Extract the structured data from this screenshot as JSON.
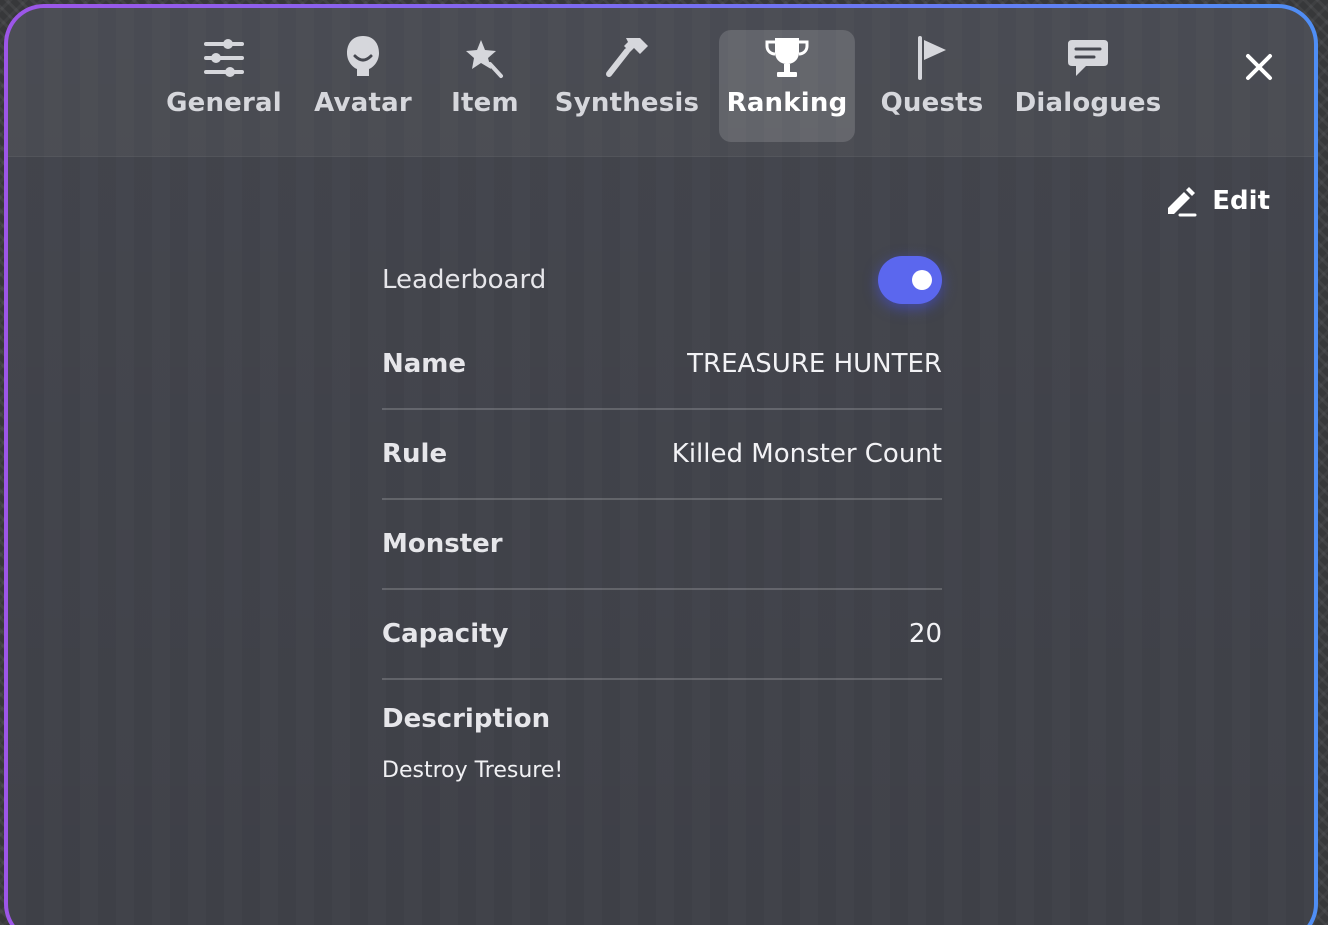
{
  "tabs": [
    {
      "label": "General",
      "icon": "sliders-icon"
    },
    {
      "label": "Avatar",
      "icon": "avatar-icon"
    },
    {
      "label": "Item",
      "icon": "star-wand-icon"
    },
    {
      "label": "Synthesis",
      "icon": "hammer-icon"
    },
    {
      "label": "Ranking",
      "icon": "trophy-icon",
      "active": true
    },
    {
      "label": "Quests",
      "icon": "flag-icon"
    },
    {
      "label": "Dialogues",
      "icon": "chat-icon"
    }
  ],
  "header": {
    "close_icon": "close-icon",
    "edit_label": "Edit",
    "edit_icon": "pencil-icon"
  },
  "form": {
    "leaderboard_label": "Leaderboard",
    "leaderboard_enabled": true,
    "name_label": "Name",
    "name_value": "TREASURE HUNTER",
    "rule_label": "Rule",
    "rule_value": "Killed Monster Count",
    "monster_label": "Monster",
    "monster_value": "",
    "capacity_label": "Capacity",
    "capacity_value": "20",
    "description_label": "Description",
    "description_value": "Destroy Tresure!"
  },
  "colors": {
    "accent": "#5b67ee",
    "border_gradient_start": "#9d56e8",
    "border_gradient_end": "#4f8ef5"
  }
}
